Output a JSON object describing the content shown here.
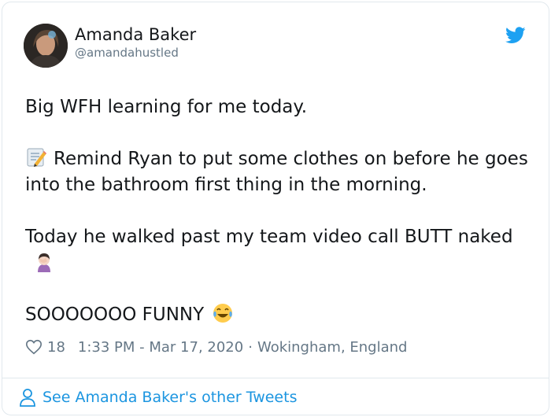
{
  "tweet": {
    "author_name": "Amanda Baker",
    "author_handle": "@amandahustled",
    "line1": "Big WFH learning for me today.",
    "line2": "Remind Ryan to put some clothes on before he goes into the bathroom first thing in the morning.",
    "line3": "Today he walked past my team video call BUTT naked",
    "line4": "SOOOOOOO FUNNY",
    "like_count": "18",
    "timestamp": "1:33 PM - Mar 17, 2020",
    "separator": "·",
    "location": "Wokingham, England",
    "footer_link": "See Amanda Baker's other Tweets"
  },
  "icons": {
    "brand": "twitter-bird-icon",
    "heart": "heart-outline-icon",
    "person": "person-icon",
    "memo": "memo-emoji",
    "facepalm": "woman-facepalming-emoji",
    "laugh": "tears-of-joy-emoji"
  },
  "colors": {
    "twitter_blue": "#1da1f2",
    "link_blue": "#1b95e0",
    "secondary_text": "#657786",
    "border": "#e1e8ed"
  }
}
